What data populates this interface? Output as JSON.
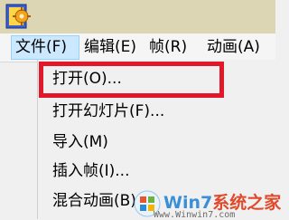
{
  "menubar": {
    "items": [
      {
        "label": "文件(F)"
      },
      {
        "label": "编辑(E)"
      },
      {
        "label": "帧(R)"
      },
      {
        "label": "动画(A)"
      }
    ]
  },
  "file_menu": {
    "items": [
      {
        "label": "打开(O)..."
      },
      {
        "label": "打开幻灯片(F)..."
      },
      {
        "label": "导入(M)"
      },
      {
        "label": "插入帧(I)..."
      },
      {
        "label": "混合动画(B)..."
      }
    ]
  },
  "watermark": {
    "brand_a": "Win7",
    "brand_b": "系统之家",
    "url": "Www.Winwin7.com"
  },
  "colors": {
    "highlight": "#e0182a",
    "active_menu": "#cce8ff",
    "titlebar": "#dcd6b4"
  }
}
